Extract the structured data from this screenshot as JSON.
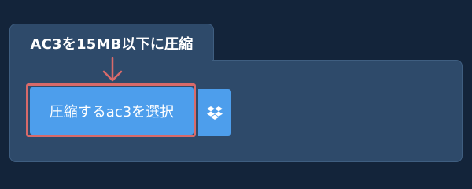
{
  "panel": {
    "title": "AC3を15MB以下に圧縮"
  },
  "upload": {
    "button_label": "圧縮するac3を選択"
  },
  "dropbox": {
    "icon": "dropbox-icon"
  },
  "colors": {
    "background": "#13243a",
    "panel": "#2e4a6a",
    "button": "#4d9eec",
    "highlight": "#d86a6a"
  }
}
